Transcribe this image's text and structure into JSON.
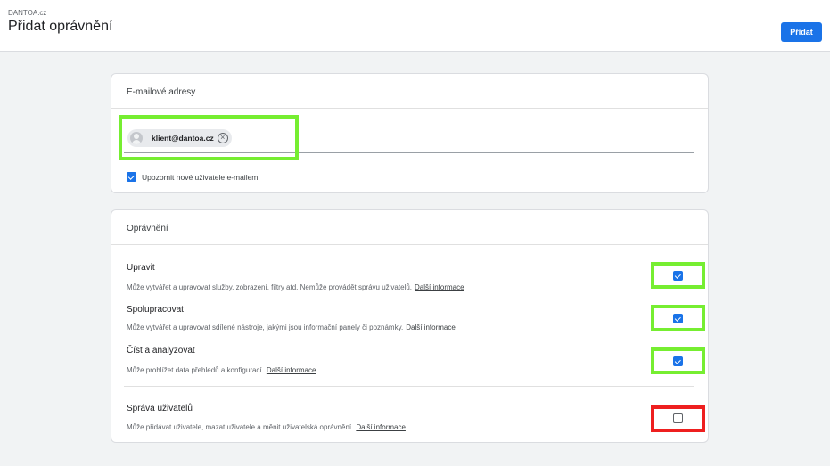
{
  "header": {
    "account": "DANTOA.cz",
    "title": "Přidat oprávnění",
    "add_label": "Přidat"
  },
  "emails": {
    "heading": "E-mailové adresy",
    "chip": "klient@dantoa.cz",
    "chip_remove": "×",
    "notify_label": "Upozornit nové uživatele e-mailem",
    "notify_checked": true
  },
  "permissions": {
    "heading": "Oprávnění",
    "link_label": "Další informace",
    "items": [
      {
        "title": "Upravit",
        "desc": "Může vytvářet a upravovat služby, zobrazení, filtry atd. Nemůže provádět správu uživatelů.",
        "checked": true
      },
      {
        "title": "Spolupracovat",
        "desc": "Může vytvářet a upravovat sdílené nástroje, jakými jsou informační panely či poznámky.",
        "checked": true
      },
      {
        "title": "Číst a analyzovat",
        "desc": "Může prohlížet data přehledů a konfigurací.",
        "checked": true
      },
      {
        "title": "Správa uživatelů",
        "desc": "Může přidávat uživatele, mazat uživatele a měnit uživatelská oprávnění.",
        "checked": false
      }
    ]
  },
  "colors": {
    "accent": "#1a73e8",
    "highlight_green": "#76ee31",
    "highlight_red": "#ee1f1f"
  }
}
